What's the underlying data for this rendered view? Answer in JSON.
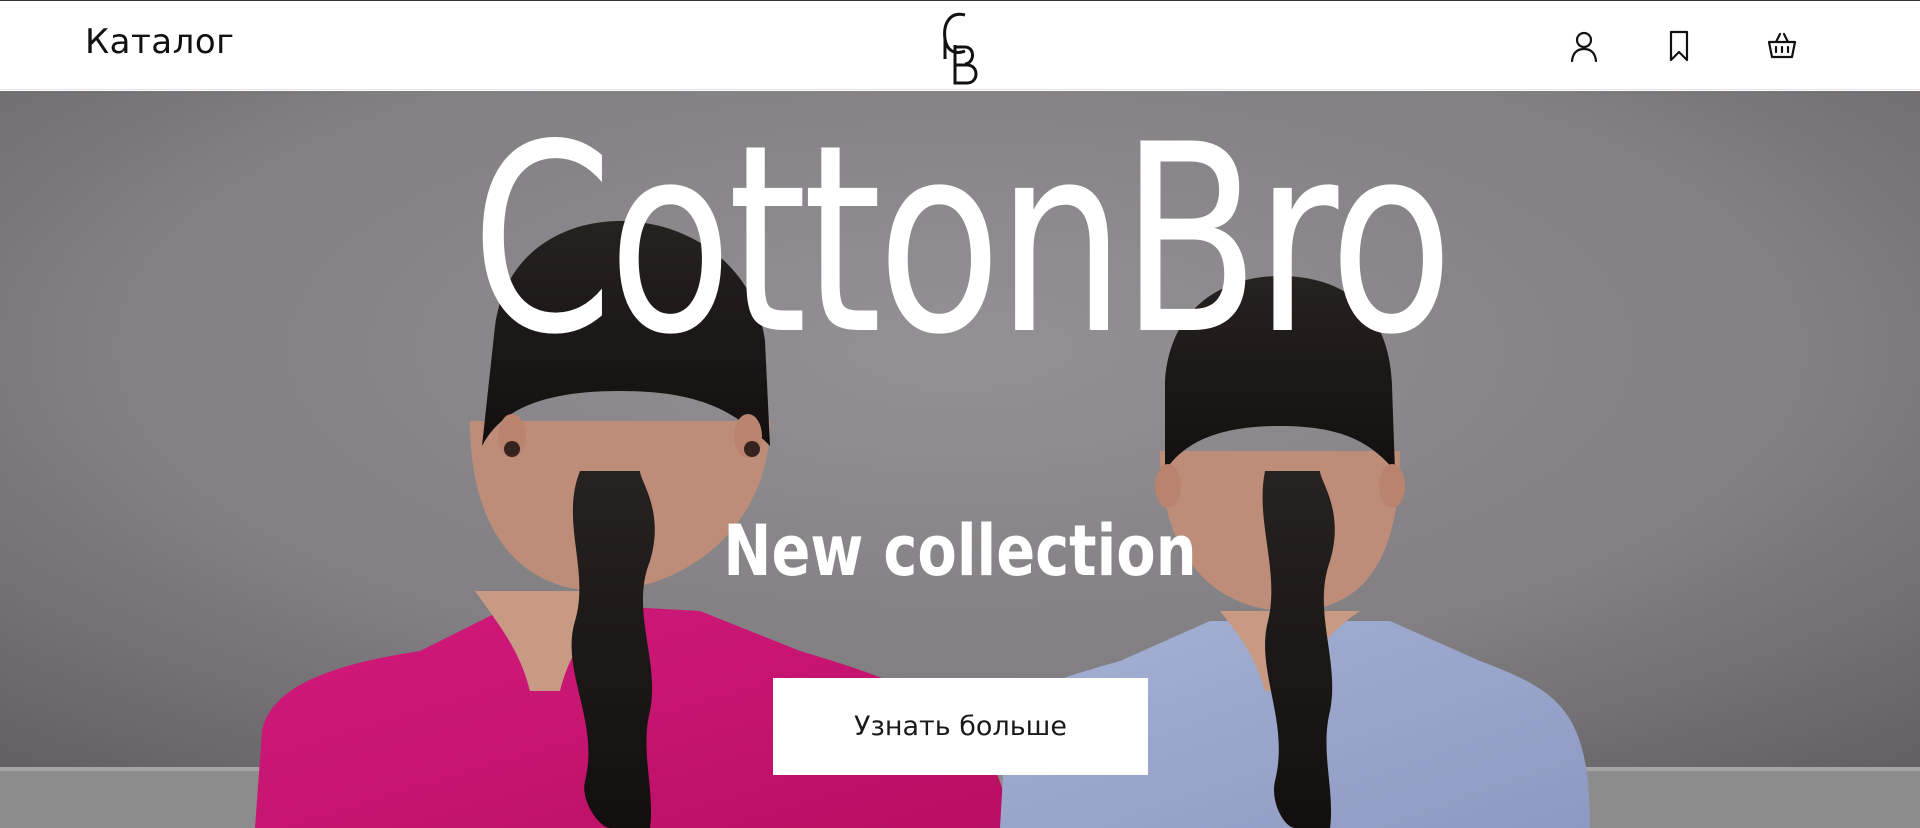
{
  "header": {
    "catalog_label": "Каталог",
    "icons": {
      "account": "user-icon",
      "favorites": "bookmark-icon",
      "cart": "basket-icon"
    }
  },
  "hero": {
    "title": "CottonBro",
    "subtitle": "New collection",
    "cta_label": "Узнать больше",
    "jacket_colors": {
      "left": "#e0157d",
      "right": "#a9b6de"
    }
  },
  "colors": {
    "header_bg": "#ffffff",
    "text": "#111111",
    "hero_text": "#ffffff",
    "button_bg": "#ffffff"
  }
}
